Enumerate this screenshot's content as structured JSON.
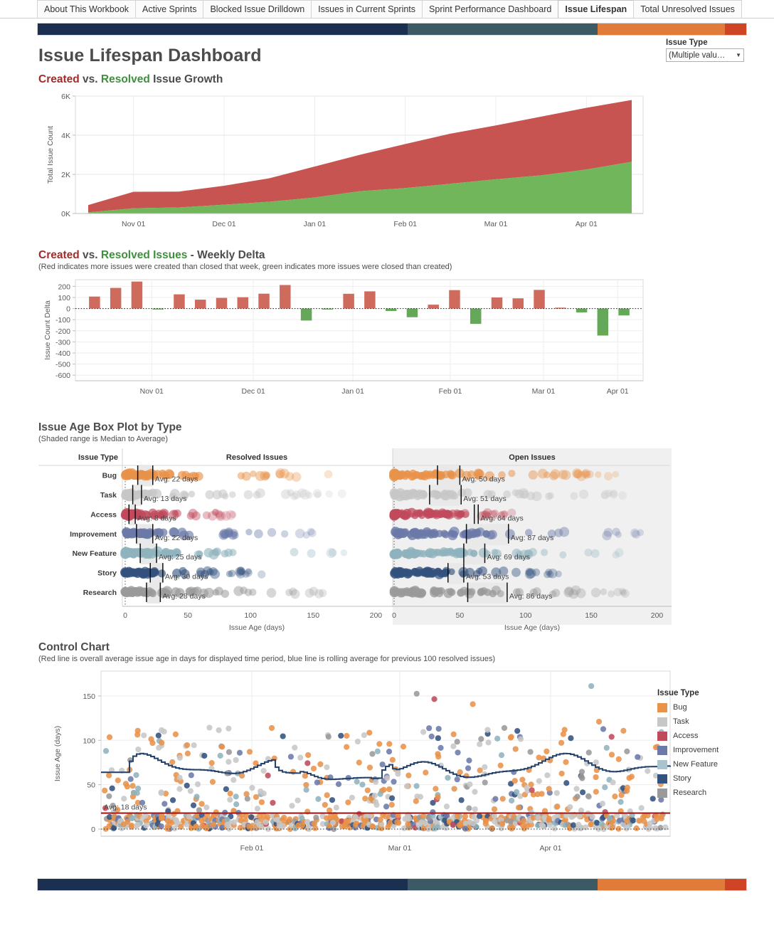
{
  "tabs": [
    {
      "label": "About This Workbook",
      "active": false
    },
    {
      "label": "Active Sprints",
      "active": false
    },
    {
      "label": "Blocked Issue Drilldown",
      "active": false
    },
    {
      "label": "Issues in Current Sprints",
      "active": false
    },
    {
      "label": "Sprint Performance Dashboard",
      "active": false
    },
    {
      "label": "Issue Lifespan",
      "active": true
    },
    {
      "label": "Total Unresolved Issues",
      "active": false
    }
  ],
  "header": {
    "title": "Issue Lifespan Dashboard",
    "filter_label": "Issue Type",
    "filter_value": "(Multiple valu…"
  },
  "sections": {
    "growth": {
      "title_part1": "Created",
      "title_part2": " vs. ",
      "title_part3": "Resolved",
      "title_part4": " Issue Growth"
    },
    "delta": {
      "title_part1": "Created",
      "title_part2": " vs. ",
      "title_part3": "Resolved Issues",
      "title_part4": " - Weekly Delta",
      "subtitle": "(Red indicates more issues were created than closed that week, green indicates more issues were closed than created)"
    },
    "boxplot": {
      "title": "Issue Age Box Plot by Type",
      "subtitle": "(Shaded range is Median to Average)"
    },
    "control": {
      "title": "Control Chart",
      "subtitle": "(Red line is overall average issue age in days for displayed time period, blue line is rolling average for previous 100 resolved issues)"
    }
  },
  "colors": {
    "created_red": "#c75450",
    "resolved_green": "#72b65c",
    "avg_line_red": "#a31b1b",
    "rolling_blue": "#28456e",
    "brand_navy": "#1b3050",
    "brand_teal": "#3b5a63",
    "brand_orange": "#e07b39",
    "brand_red": "#cf4424",
    "bug": "#e8924a",
    "task": "#c7c7c7",
    "access": "#c04a5c",
    "improvement": "#6b7aa8",
    "new_feature": "#8fb3bd",
    "story": "#33527e",
    "research": "#9a9a9a"
  },
  "legend": {
    "title": "Issue Type",
    "items": [
      {
        "label": "Bug",
        "color": "#e8924a"
      },
      {
        "label": "Task",
        "color": "#c7c7c7"
      },
      {
        "label": "Access",
        "color": "#c04a5c"
      },
      {
        "label": "Improvement",
        "color": "#6b7aa8"
      },
      {
        "label": "New Feature",
        "color": "#8fb3bd"
      },
      {
        "label": "Story",
        "color": "#33527e"
      },
      {
        "label": "Research",
        "color": "#9a9a9a"
      }
    ]
  },
  "chart_data": [
    {
      "type": "area",
      "id": "created-vs-resolved-growth",
      "title": "Created vs. Resolved Issue Growth",
      "xlabel": "",
      "ylabel": "Total Issue Count",
      "ytick_labels": [
        "0K",
        "2K",
        "4K",
        "6K"
      ],
      "ytick_values": [
        0,
        2000,
        4000,
        6000
      ],
      "ylim": [
        0,
        6000
      ],
      "xtick_labels": [
        "Nov 01",
        "Dec 01",
        "Jan 01",
        "Feb 01",
        "Mar 01",
        "Apr 01"
      ],
      "x": [
        "Oct 15",
        "Nov 01",
        "Nov 15",
        "Dec 01",
        "Dec 15",
        "Jan 01",
        "Jan 15",
        "Feb 01",
        "Feb 15",
        "Mar 01",
        "Mar 15",
        "Apr 01",
        "Apr 15"
      ],
      "series": [
        {
          "name": "Created",
          "color": "#c75450",
          "values": [
            430,
            1110,
            1120,
            1420,
            1800,
            2400,
            3000,
            3550,
            4080,
            4500,
            4950,
            5400,
            5800
          ]
        },
        {
          "name": "Resolved",
          "color": "#72b65c",
          "values": [
            60,
            270,
            310,
            450,
            600,
            820,
            1140,
            1300,
            1520,
            1750,
            1950,
            2250,
            2640
          ]
        }
      ],
      "grid": true
    },
    {
      "type": "bar",
      "id": "weekly-delta",
      "title": "Created vs. Resolved Issues - Weekly Delta",
      "subtitle": "(Red indicates more issues were created than closed that week, green indicates more issues were closed than created)",
      "xlabel": "",
      "ylabel": "Issue Count Delta",
      "ytick_labels": [
        "200",
        "100",
        "0",
        "-100",
        "-200",
        "-300",
        "-400",
        "-500",
        "-600"
      ],
      "ytick_values": [
        200,
        100,
        0,
        -100,
        -200,
        -300,
        -400,
        -500,
        -600
      ],
      "ylim": [
        -650,
        260
      ],
      "xtick_labels": [
        "Nov 01",
        "Dec 01",
        "Jan 01",
        "Feb 01",
        "Mar 01",
        "Apr 01"
      ],
      "values": [
        108,
        186,
        243,
        -3,
        128,
        80,
        96,
        102,
        134,
        212,
        -108,
        -4,
        133,
        155,
        -22,
        -78,
        35,
        166,
        -138,
        100,
        92,
        168,
        8,
        -35,
        -243,
        -62
      ],
      "grid": true
    },
    {
      "type": "boxplot",
      "id": "issue-age-box-plot-by-type",
      "title": "Issue Age Box Plot by Type",
      "subtitle": "(Shaded range is Median to Average)",
      "row_header": "Issue Type",
      "panels": [
        "Resolved Issues",
        "Open Issues"
      ],
      "xlabel": "Issue Age (days)",
      "xtick_labels": [
        "0",
        "50",
        "100",
        "150",
        "200"
      ],
      "xtick_values": [
        0,
        50,
        100,
        150,
        200
      ],
      "xlim": [
        0,
        210
      ],
      "categories": [
        "Bug",
        "Task",
        "Access",
        "Improvement",
        "New Feature",
        "Story",
        "Research"
      ],
      "resolved": [
        {
          "type": "Bug",
          "color": "#e8924a",
          "median": 10,
          "avg": 22,
          "avg_label": "Avg: 22 days",
          "max": 170
        },
        {
          "type": "Task",
          "color": "#c7c7c7",
          "median": 6,
          "avg": 13,
          "avg_label": "Avg: 13 days",
          "max": 175
        },
        {
          "type": "Access",
          "color": "#c04a5c",
          "median": 3,
          "avg": 8,
          "avg_label": "Avg: 8 days",
          "max": 86
        },
        {
          "type": "Improvement",
          "color": "#6b7aa8",
          "median": 9,
          "avg": 22,
          "avg_label": "Avg: 22 days",
          "max": 155
        },
        {
          "type": "New Feature",
          "color": "#8fb3bd",
          "median": 12,
          "avg": 25,
          "avg_label": "Avg: 25 days",
          "max": 180
        },
        {
          "type": "Story",
          "color": "#33527e",
          "median": 20,
          "avg": 30,
          "avg_label": "Avg: 30 days",
          "max": 112
        },
        {
          "type": "Research",
          "color": "#9a9a9a",
          "median": 17,
          "avg": 28,
          "avg_label": "Avg: 28 days",
          "max": 165
        }
      ],
      "open": [
        {
          "type": "Bug",
          "color": "#e8924a",
          "median": 33,
          "avg": 50,
          "avg_label": "Avg: 50 days",
          "max": 172
        },
        {
          "type": "Task",
          "color": "#c7c7c7",
          "median": 27,
          "avg": 51,
          "avg_label": "Avg: 51 days",
          "max": 190
        },
        {
          "type": "Access",
          "color": "#c04a5c",
          "median": 61,
          "avg": 64,
          "avg_label": "Avg: 64 days",
          "max": 96
        },
        {
          "type": "Improvement",
          "color": "#6b7aa8",
          "median": 55,
          "avg": 87,
          "avg_label": "Avg: 87 days",
          "max": 190
        },
        {
          "type": "New Feature",
          "color": "#8fb3bd",
          "median": 53,
          "avg": 69,
          "avg_label": "Avg: 69 days",
          "max": 178
        },
        {
          "type": "Story",
          "color": "#33527e",
          "median": 41,
          "avg": 53,
          "avg_label": "Avg: 53 days",
          "max": 138
        },
        {
          "type": "Research",
          "color": "#9a9a9a",
          "median": 56,
          "avg": 86,
          "avg_label": "Avg: 86 days",
          "max": 178
        }
      ]
    },
    {
      "type": "scatter",
      "id": "control-chart",
      "title": "Control Chart",
      "subtitle": "(Red line is overall average issue age in days for displayed time period, blue line is rolling average for previous 100 resolved issues)",
      "xlabel": "",
      "ylabel": "Issue Age (days)",
      "ytick_labels": [
        "0",
        "50",
        "100",
        "150"
      ],
      "ytick_values": [
        0,
        50,
        100,
        150
      ],
      "ylim": [
        -8,
        178
      ],
      "xtick_labels": [
        "Feb 01",
        "Mar 01",
        "Apr 01"
      ],
      "average_line": {
        "value": 18,
        "label": "Avg: 18 days",
        "color": "#a31b1b"
      },
      "rolling_average": {
        "label": "rolling average for previous 100 resolved issues",
        "color": "#28456e",
        "approx_range": [
          55,
          92
        ]
      },
      "point_colors": [
        "#e8924a",
        "#c7c7c7",
        "#c04a5c",
        "#6b7aa8",
        "#8fb3bd",
        "#33527e",
        "#9a9a9a"
      ]
    }
  ]
}
